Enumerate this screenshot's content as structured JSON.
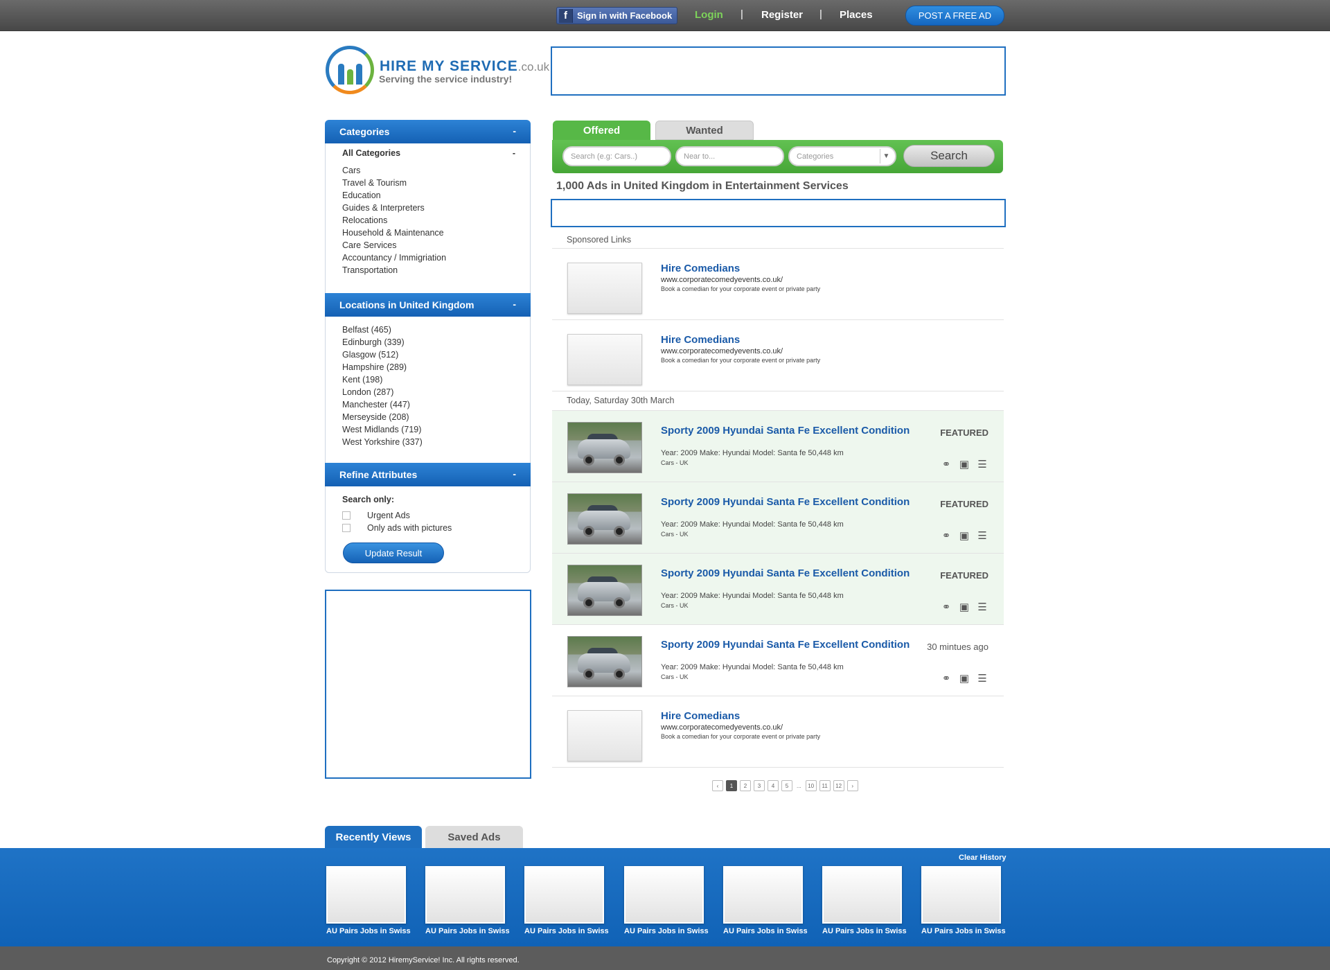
{
  "header": {
    "facebook_label": "Sign in with Facebook",
    "facebook_icon": "f",
    "login": "Login",
    "register": "Register",
    "places": "Places",
    "separator": "|",
    "post_ad": "POST A FREE AD"
  },
  "logo": {
    "name": "HIRE MY SERVICE",
    "domain": ".co.uk",
    "tagline": "Serving the service industry!"
  },
  "sidebar": {
    "categories_title": "Categories",
    "collapse": "-",
    "all_categories": "All Categories",
    "categories": [
      "Cars",
      "Travel & Tourism",
      "Education",
      "Guides & Interpreters",
      "Relocations",
      "Household & Maintenance",
      "Care Services",
      "Accountancy / Immigriation",
      "Transportation"
    ],
    "locations_title": "Locations in United Kingdom",
    "locations": [
      "Belfast (465)",
      "Edinburgh (339)",
      "Glasgow (512)",
      "Hampshire (289)",
      "Kent (198)",
      "London (287)",
      "Manchester (447)",
      "Merseyside (208)",
      "West Midlands (719)",
      "West Yorkshire (337)"
    ],
    "refine_title": "Refine Attributes",
    "search_only": "Search only:",
    "urgent_ads": "Urgent Ads",
    "only_pictures": "Only ads with pictures",
    "update_button": "Update Result"
  },
  "search": {
    "tab_offered": "Offered",
    "tab_wanted": "Wanted",
    "search_placeholder": "Search (e.g: Cars..)",
    "near_placeholder": "Near to...",
    "categories_select": "Categories",
    "select_arrow": "▼",
    "button": "Search"
  },
  "results": {
    "title": "1,000 Ads in United Kingdom in Entertainment Services",
    "sponsored_label": "Sponsored Links",
    "date_label": "Today, Saturday 30th March",
    "sponsored": [
      {
        "title": "Hire Comedians",
        "url": "www.corporatecomedyevents.co.uk/",
        "desc": "Book a comedian for your corporate event or private party"
      },
      {
        "title": "Hire Comedians",
        "url": "www.corporatecomedyevents.co.uk/",
        "desc": "Book a comedian for your corporate event or private party"
      }
    ],
    "listings": [
      {
        "title": "Sporty 2009 Hyundai Santa Fe Excellent Condition",
        "sub": "Year: 2009 Make: Hyundai Model: Santa fe 50,448 km",
        "meta": "Cars  -  UK",
        "badge": "FEATURED"
      },
      {
        "title": "Sporty 2009 Hyundai Santa Fe Excellent Condition",
        "sub": "Year: 2009 Make: Hyundai Model: Santa fe 50,448 km",
        "meta": "Cars  -  UK",
        "badge": "FEATURED"
      },
      {
        "title": "Sporty 2009 Hyundai Santa Fe Excellent Condition",
        "sub": "Year: 2009 Make: Hyundai Model: Santa fe 50,448 km",
        "meta": "Cars  -  UK",
        "badge": "FEATURED"
      },
      {
        "title": "Sporty 2009 Hyundai Santa Fe Excellent Condition",
        "sub": "Year: 2009 Make: Hyundai Model: Santa fe 50,448 km",
        "meta": "Cars  -  UK",
        "time": "30 mintues ago"
      }
    ],
    "sponsored_bottom": {
      "title": "Hire Comedians",
      "url": "www.corporatecomedyevents.co.uk/",
      "desc": "Book a comedian for your corporate event or private party"
    },
    "row_icons": {
      "share": "share-icon",
      "save": "save-icon",
      "details": "document-icon"
    }
  },
  "pagination": {
    "prev": "‹",
    "pages": [
      "1",
      "2",
      "3",
      "4",
      "5"
    ],
    "dots": "...",
    "last_pages": [
      "10",
      "11",
      "12"
    ],
    "next": "›",
    "current": "1"
  },
  "bottom": {
    "tab_recent": "Recently Views",
    "tab_saved": "Saved Ads",
    "clear_history": "Clear History",
    "items": [
      "AU Pairs Jobs in Swiss",
      "AU Pairs Jobs in Swiss",
      "AU Pairs Jobs in Swiss",
      "AU Pairs Jobs in Swiss",
      "AU Pairs Jobs in Swiss",
      "AU Pairs Jobs in Swiss",
      "AU Pairs Jobs in Swiss"
    ]
  },
  "footer": {
    "copyright": "Copyright © 2012 HiremyService! Inc. All rights reserved."
  },
  "colors": {
    "brand_blue": "#1e6fc0",
    "offered_green": "#57b847",
    "login_green": "#7dd35a",
    "featured_bg": "#eef7ee"
  }
}
